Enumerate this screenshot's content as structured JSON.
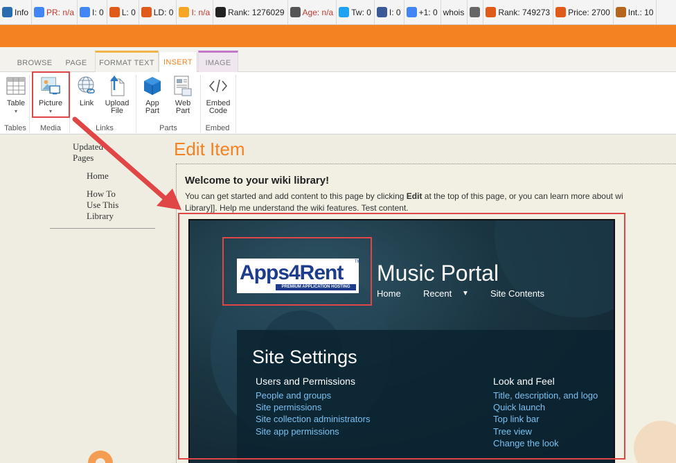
{
  "seo_toolbar": [
    {
      "label": "Info",
      "icon": "info-icon",
      "color": "#2b6cb0"
    },
    {
      "label": "PR: n/a",
      "icon": "google-icon",
      "color": "#4285f4",
      "red": true
    },
    {
      "label": "I: 0",
      "icon": "google-icon",
      "color": "#4285f4"
    },
    {
      "label": "L: 0",
      "icon": "sun-icon",
      "color": "#e05a1a"
    },
    {
      "label": "LD: 0",
      "icon": "sun-icon",
      "color": "#e05a1a"
    },
    {
      "label": "I: n/a",
      "icon": "bing-icon",
      "color": "#f5a623",
      "red": true
    },
    {
      "label": "Rank: 1276029",
      "icon": "alexa-icon",
      "color": "#222"
    },
    {
      "label": "Age: n/a",
      "icon": "barcode-icon",
      "color": "#555",
      "red": true
    },
    {
      "label": "Tw: 0",
      "icon": "twitter-icon",
      "color": "#1da1f2"
    },
    {
      "label": "I: 0",
      "icon": "facebook-icon",
      "color": "#3b5998"
    },
    {
      "label": "+1: 0",
      "icon": "google-icon",
      "color": "#4285f4"
    },
    {
      "label": "whois",
      "icon": "",
      "color": ""
    },
    {
      "label": "",
      "icon": "code-icon",
      "color": "#666"
    },
    {
      "label": "Rank: 749273",
      "icon": "sun-icon",
      "color": "#e05a1a"
    },
    {
      "label": "Price: 2700",
      "icon": "sun-icon",
      "color": "#e05a1a"
    },
    {
      "label": "Int.: 10",
      "icon": "hand-icon",
      "color": "#b5651d"
    }
  ],
  "ribbon_tabs": {
    "browse": "BROWSE",
    "page": "PAGE",
    "format_text": "FORMAT TEXT",
    "insert": "INSERT",
    "image": "IMAGE"
  },
  "ribbon": {
    "table": "Table",
    "picture": "Picture",
    "link": "Link",
    "upload_file_1": "Upload",
    "upload_file_2": "File",
    "app_part_1": "App",
    "app_part_2": "Part",
    "web_part_1": "Web",
    "web_part_2": "Part",
    "embed_code_1": "Embed",
    "embed_code_2": "Code",
    "groups": {
      "tables": "Tables",
      "media": "Media",
      "links": "Links",
      "parts": "Parts",
      "embed": "Embed"
    }
  },
  "left_nav": {
    "updated_pages_1": "Updated",
    "updated_pages_2": "Pages",
    "home": "Home",
    "how_to_1": "How To",
    "how_to_2": "Use This",
    "how_to_3": "Library"
  },
  "page_title": "Edit Item",
  "content": {
    "welcome": "Welcome to your wiki library!",
    "intro_before": "You can get started and add content to this page by clicking ",
    "intro_bold": "Edit",
    "intro_after": " at the top of this page, or you can learn more about wi",
    "intro_line2": "Library]]. Help me understand the wiki features. Test content."
  },
  "picture": {
    "logo_main": "Apps4Rent",
    "logo_tm": "TM",
    "logo_sub": "PREMIUM APPLICATION HOSTING",
    "portal_title": "Music Portal",
    "nav_home": "Home",
    "nav_recent": "Recent",
    "nav_site_contents": "Site Contents",
    "settings_title": "Site Settings",
    "users_heading": "Users and Permissions",
    "users_links": [
      "People and groups",
      "Site permissions",
      "Site collection administrators",
      "Site app permissions"
    ],
    "look_heading": "Look and Feel",
    "look_links": [
      "Title, description, and logo",
      "Quick launch",
      "Top link bar",
      "Tree view",
      "Change the look"
    ]
  },
  "colors": {
    "accent": "#f58220",
    "highlight": "#e04646",
    "link": "#7cc0f0"
  }
}
